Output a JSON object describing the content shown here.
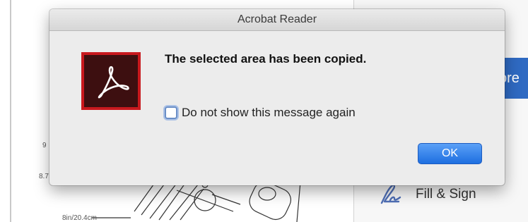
{
  "dialog": {
    "title": "Acrobat Reader",
    "message": "The selected area has been copied.",
    "checkbox_label": "Do not show this message again",
    "checkbox_checked": false,
    "ok_label": "OK",
    "app_icon": "adobe-acrobat-icon"
  },
  "background": {
    "doc_labels": [
      "9",
      "8.7",
      "8in/20.4cm"
    ],
    "right_panel": {
      "tool_tile_text": "pre",
      "fill_sign_label": "Fill & Sign",
      "fill_sign_icon": "signature-pen-icon"
    }
  },
  "colors": {
    "accent_blue": "#2f6ac2",
    "ok_button": "#1e6fe0",
    "acrobat_red": "#c8191e",
    "acrobat_dark": "#3d0f10"
  }
}
